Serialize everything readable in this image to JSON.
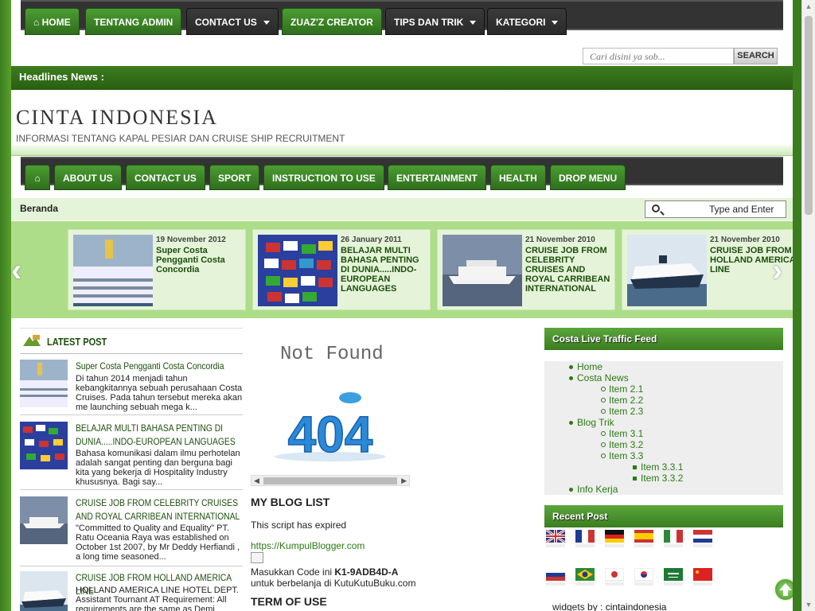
{
  "top_nav": [
    {
      "label": "HOME",
      "icon": "home-icon"
    },
    {
      "label": "TENTANG ADMIN"
    },
    {
      "label": "CONTACT US",
      "dropdown": true
    },
    {
      "label": "ZUAZ'Z CREATOR"
    },
    {
      "label": "TIPS DAN TRIK",
      "dropdown": true
    },
    {
      "label": "KATEGORI",
      "dropdown": true
    }
  ],
  "search": {
    "placeholder": "Cari disini ya sob...",
    "button": "SEARCH"
  },
  "headline": {
    "label": "Headlines News :"
  },
  "site": {
    "title": "CINTA INDONESIA",
    "description": "INFORMASI TENTANG KAPAL PESIAR DAN CRUISE SHIP RECRUITMENT"
  },
  "main_nav": [
    "ABOUT US",
    "CONTACT US",
    "SPORT",
    "INSTRUCTION TO USE",
    "ENTERTAINMENT",
    "HEALTH",
    "DROP MENU"
  ],
  "breadcrumb": "Beranda",
  "search2": {
    "placeholder": "Type and Enter"
  },
  "slides": [
    {
      "date": "19 November 2012",
      "title": "Super Costa Pengganti Costa Concordia"
    },
    {
      "date": "26 January 2011",
      "title": "BELAJAR MULTI BAHASA PENTING DI DUNIA.....INDO-EUROPEAN LANGUAGES"
    },
    {
      "date": "21 November 2010",
      "title": "CRUISE JOB FROM CELEBRITY CRUISES AND ROYAL CARRIBEAN INTERNATIONAL"
    },
    {
      "date": "21 November 2010",
      "title": "CRUISE JOB FROM HOLLAND AMERICA LINE"
    }
  ],
  "latest": {
    "heading": "LATEST POST",
    "posts": [
      {
        "title": "Super Costa Pengganti Costa Concordia",
        "excerpt": "Di tahun 2014 menjadi tahun kebangkitannya sebuah perusahaan Costa Cruises. Pada tahun tersebut mereka akan me launching sebuah mega k..."
      },
      {
        "title": "BELAJAR MULTI BAHASA PENTING DI DUNIA.....INDO-EUROPEAN LANGUAGES",
        "excerpt": "Bahasa komunikasi dalam ilmu perhotelan adalah sangat penting dan berguna bagi kita yang bekerja di Hospitality Industry khususnya. Bagi say..."
      },
      {
        "title": "CRUISE JOB FROM CELEBRITY CRUISES AND ROYAL CARRIBEAN INTERNATIONAL",
        "excerpt": "\"Committed to Quality and Equality\" PT. Ratu Oceania Raya was established on October 1st 2007, by Mr Deddy Herfiandi , a long time seasoned..."
      },
      {
        "title": "CRUISE JOB FROM HOLLAND AMERICA LINE",
        "excerpt": "HOLLAND AMERICA LINE HOTEL DEPT. Assistant Tournant AT Requirement: All requirements are the same as Demi Chef..."
      }
    ]
  },
  "center": {
    "not_found": "Not Found",
    "error_code": "404",
    "blog_list_heading": "MY BLOG LIST",
    "expired": "This script has expired",
    "link": "https://KumpulBlogger.com",
    "code_prefix": "Masukkan Code ini ",
    "code": "K1-9ADB4D-A",
    "code_suffix": "untuk berbelanja di KutuKutuBuku.com",
    "term_heading": "TERM OF USE"
  },
  "sidebar": {
    "traffic_heading": "Costa Live Traffic Feed",
    "menu": {
      "home": "Home",
      "costa_news": "Costa News",
      "item21": "Item 2.1",
      "item22": "Item 2.2",
      "item23": "Item 2.3",
      "blog_trik": "Blog Trik",
      "item31": "Item 3.1",
      "item32": "Item 3.2",
      "item33": "Item 3.3",
      "item331": "Item 3.3.1",
      "item332": "Item 3.3.2",
      "info_kerja": "Info Kerja"
    },
    "recent_heading": "Recent Post",
    "flags": [
      "uk-flag-icon",
      "france-flag-icon",
      "germany-flag-icon",
      "spain-flag-icon",
      "italy-flag-icon",
      "netherlands-flag-icon",
      "russia-flag-icon",
      "brazil-flag-icon",
      "japan-flag-icon",
      "korea-flag-icon",
      "saudi-flag-icon",
      "china-flag-icon"
    ],
    "widgets_prefix": "widgets by : ",
    "widgets_link": "cintaindonesia"
  },
  "colors": {
    "brand_green": "#3b7d1f",
    "link_green": "#2a7a14"
  }
}
